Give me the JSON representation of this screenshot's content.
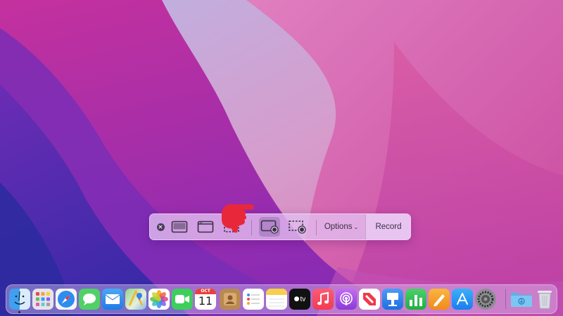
{
  "toolbar": {
    "close_icon": "close-circle-icon",
    "buttons": [
      {
        "name": "capture-entire-screen",
        "icon": "screen-icon"
      },
      {
        "name": "capture-selected-window",
        "icon": "window-icon"
      },
      {
        "name": "capture-selected-portion",
        "icon": "dashed-rect-icon"
      },
      {
        "name": "record-entire-screen",
        "icon": "screen-record-icon",
        "selected": true
      },
      {
        "name": "record-selected-portion",
        "icon": "dashed-record-icon"
      }
    ],
    "options_label": "Options",
    "options_chevron": "⌄",
    "record_label": "Record"
  },
  "dock": {
    "calendar_month": "OCT",
    "calendar_day": "11",
    "tv_label": "tv",
    "apps": [
      "Finder",
      "Launchpad",
      "Safari",
      "Messages",
      "Mail",
      "Maps",
      "Photos",
      "FaceTime",
      "Calendar",
      "Contacts",
      "Reminders",
      "Notes",
      "TV",
      "Music",
      "Podcasts",
      "News",
      "Keynote",
      "Numbers",
      "Pages",
      "App Store",
      "System Preferences",
      "Downloads",
      "Trash"
    ]
  },
  "colors": {
    "wallpaper_magenta": "#c63aa4",
    "wallpaper_purple": "#5a2bb0",
    "wallpaper_pink": "#e47ab8",
    "hand": "#e8283a"
  }
}
